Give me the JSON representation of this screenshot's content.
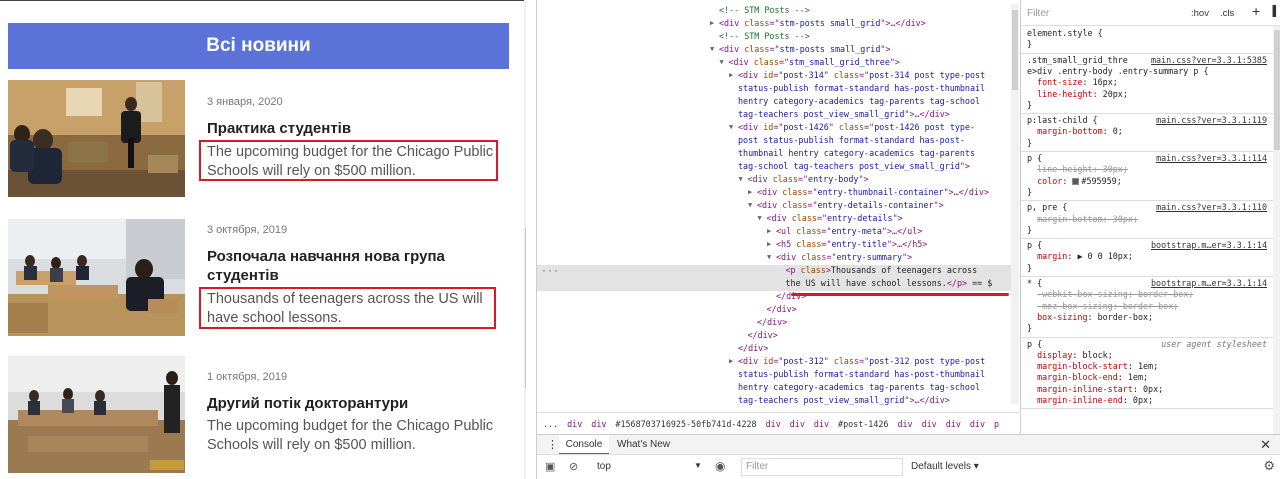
{
  "site": {
    "banner_title": "Всі новини",
    "posts": [
      {
        "date": "3 января, 2020",
        "title": "Практика студентів",
        "summary": "The upcoming budget for the Chicago Public Schools will rely on $500 million."
      },
      {
        "date": "3 октября, 2019",
        "title": "Розпочала навчання нова група студентів",
        "summary": "Thousands of teenagers across the US will have school lessons."
      },
      {
        "date": "1 октября, 2019",
        "title": "Другий потік докторантури",
        "summary": "The upcoming budget for the Chicago Public Schools will rely on $500 million."
      }
    ]
  },
  "devtools": {
    "elements": {
      "lines": [
        {
          "indent": 0,
          "tri": "",
          "html": "<span class='cmt'>&lt;!-- STM Posts --&gt;</span>"
        },
        {
          "indent": 0,
          "tri": "▶",
          "html": "<span class='tag'>&lt;div</span> <span class='attr'>class</span>=\"<span class='val'>stm-posts small_grid</span>\"<span class='tag'>&gt;</span>…<span class='tag'>&lt;/div&gt;</span>"
        },
        {
          "indent": 0,
          "tri": "",
          "html": "<span class='cmt'>&lt;!-- STM Posts --&gt;</span>"
        },
        {
          "indent": 0,
          "tri": "▼",
          "html": "<span class='tag'>&lt;div</span> <span class='attr'>class</span>=\"<span class='val'>stm-posts small_grid</span>\"<span class='tag'>&gt;</span>"
        },
        {
          "indent": 1,
          "tri": "▼",
          "html": "<span class='tag'>&lt;div</span> <span class='attr'>class</span>=\"<span class='val'>stm_small_grid_three</span>\"<span class='tag'>&gt;</span>"
        },
        {
          "indent": 2,
          "tri": "▶",
          "html": "<span class='tag'>&lt;div</span> <span class='attr'>id</span>=\"<span class='val'>post-314</span>\" <span class='attr'>class</span>=\"<span class='val'>post-314 post type-post</span>"
        },
        {
          "indent": 2,
          "tri": "",
          "html": "<span class='val'>status-publish format-standard has-post-thumbnail</span>"
        },
        {
          "indent": 2,
          "tri": "",
          "html": "<span class='val'>hentry category-academics tag-parents tag-school</span>"
        },
        {
          "indent": 2,
          "tri": "",
          "html": "<span class='val'>tag-teachers post_view_small_grid</span>\"<span class='tag'>&gt;</span>…<span class='tag'>&lt;/div&gt;</span>"
        },
        {
          "indent": 2,
          "tri": "▼",
          "html": "<span class='tag'>&lt;div</span> <span class='attr'>id</span>=\"<span class='val'>post-1426</span>\" <span class='attr'>class</span>=\"<span class='val'>post-1426 post type-</span>"
        },
        {
          "indent": 2,
          "tri": "",
          "html": "<span class='val'>post status-publish format-standard has-post-</span>"
        },
        {
          "indent": 2,
          "tri": "",
          "html": "<span class='val'>thumbnail hentry category-academics tag-parents</span>"
        },
        {
          "indent": 2,
          "tri": "",
          "html": "<span class='val'>tag-school tag-teachers post_view_small_grid</span>\"<span class='tag'>&gt;</span>"
        },
        {
          "indent": 3,
          "tri": "▼",
          "html": "<span class='tag'>&lt;div</span> <span class='attr'>class</span>=\"<span class='val'>entry-body</span>\"<span class='tag'>&gt;</span>"
        },
        {
          "indent": 4,
          "tri": "▶",
          "html": "<span class='tag'>&lt;div</span> <span class='attr'>class</span>=\"<span class='val'>entry-thumbnail-container</span>\"<span class='tag'>&gt;</span>…<span class='tag'>&lt;/div&gt;</span>"
        },
        {
          "indent": 4,
          "tri": "▼",
          "html": "<span class='tag'>&lt;div</span> <span class='attr'>class</span>=\"<span class='val'>entry-details-container</span>\"<span class='tag'>&gt;</span>"
        },
        {
          "indent": 5,
          "tri": "▼",
          "html": "<span class='tag'>&lt;div</span> <span class='attr'>class</span>=\"<span class='val'>entry-details</span>\"<span class='tag'>&gt;</span>"
        },
        {
          "indent": 6,
          "tri": "▶",
          "html": "<span class='tag'>&lt;ul</span> <span class='attr'>class</span>=\"<span class='val'>entry-meta</span>\"<span class='tag'>&gt;</span>…<span class='tag'>&lt;/ul&gt;</span>"
        },
        {
          "indent": 6,
          "tri": "▶",
          "html": "<span class='tag'>&lt;h5</span> <span class='attr'>class</span>=\"<span class='val'>entry-title</span>\"<span class='tag'>&gt;</span>…<span class='tag'>&lt;/h5&gt;</span>"
        },
        {
          "indent": 6,
          "tri": "▼",
          "html": "<span class='tag'>&lt;div</span> <span class='attr'>class</span>=\"<span class='val'>entry-summary</span>\"<span class='tag'>&gt;</span>"
        },
        {
          "indent": 7,
          "tri": "",
          "html": "<span class='tag'>&lt;p</span> <span class='attr'>class</span><span class='tag'>&gt;</span><span class='txt'>Thousands of teenagers across</span>"
        },
        {
          "indent": 7,
          "tri": "",
          "html": "<span class='txt'>the US will have school lessons.</span><span class='tag'>&lt;/p&gt;</span> <span class='txt'>== $</span>"
        },
        {
          "indent": 6,
          "tri": "",
          "html": "<span class='tag'>&lt;/div&gt;</span>"
        },
        {
          "indent": 5,
          "tri": "",
          "html": "<span class='tag'>&lt;/div&gt;</span>"
        },
        {
          "indent": 4,
          "tri": "",
          "html": "<span class='tag'>&lt;/div&gt;</span>"
        },
        {
          "indent": 3,
          "tri": "",
          "html": "<span class='tag'>&lt;/div&gt;</span>"
        },
        {
          "indent": 2,
          "tri": "",
          "html": "<span class='tag'>&lt;/div&gt;</span>"
        },
        {
          "indent": 2,
          "tri": "▶",
          "html": "<span class='tag'>&lt;div</span> <span class='attr'>id</span>=\"<span class='val'>post-312</span>\" <span class='attr'>class</span>=\"<span class='val'>post-312 post type-post</span>"
        },
        {
          "indent": 2,
          "tri": "",
          "html": "<span class='val'>status-publish format-standard has-post-thumbnail</span>"
        },
        {
          "indent": 2,
          "tri": "",
          "html": "<span class='val'>hentry category-academics tag-parents tag-school</span>"
        },
        {
          "indent": 2,
          "tri": "",
          "html": "<span class='val'>tag-teachers post_view_small_grid</span>\"<span class='tag'>&gt;</span>…<span class='tag'>&lt;/div&gt;</span>"
        }
      ],
      "selected_dots": "···"
    },
    "breadcrumb": [
      "...",
      "div",
      "div",
      "#1568703716925-50fb741d-4228",
      "div",
      "div",
      "div",
      "#post-1426",
      "div",
      "div",
      "div",
      "div",
      "p"
    ],
    "styles": {
      "filter_placeholder": "Filter",
      "hov": ":hov",
      "cls": ".cls",
      "plus": "+",
      "rules": [
        {
          "lines": [
            "<span class='pval'>element.style {</span>",
            "<span class='pval'>}</span>"
          ],
          "src": ""
        },
        {
          "lines": [
            "<span class='pval'>.stm_small_grid_thre</span>",
            "<span class='pval'>e&gt;div .entry-body .entry-summary p {</span>",
            "  <span class='pname'>font-size</span>: <span class='pval'>16px;</span>",
            "  <span class='pname'>line-height</span>: <span class='pval'>20px;</span>",
            "<span class='pval'>}</span>"
          ],
          "src": "main.css?ver=3.3.1:5385"
        },
        {
          "lines": [
            "<span class='pval'>p:last-child {</span>",
            "  <span class='pname'>margin-bottom</span>: <span class='pval'>0;</span>",
            "<span class='pval'>}</span>"
          ],
          "src": "main.css?ver=3.3.1:119"
        },
        {
          "lines": [
            "<span class='pval'>p {</span>",
            "  <span class='strike'><span class='pname'>line-height</span>: 30px;</span>",
            "  <span class='pname'>color</span>: <span class='swatch'></span><span class='pval'>#595959;</span>",
            "<span class='pval'>}</span>"
          ],
          "src": "main.css?ver=3.3.1:114"
        },
        {
          "lines": [
            "<span class='pval'>p, pre {</span>",
            "  <span class='strike'><span class='pname'>margin-bottom</span>: 30px;</span>",
            "<span class='pval'>}</span>"
          ],
          "src": "main.css?ver=3.3.1:110"
        },
        {
          "lines": [
            "<span class='pval'>p {</span>",
            "  <span class='pname'>margin</span>: <span class='pval'>▶ 0 0 10px;</span>",
            "<span class='pval'>}</span>"
          ],
          "src": "bootstrap.m…er=3.3.1:14"
        },
        {
          "lines": [
            "<span class='pval'>* {</span>",
            "  <span class='strike'><span class='pname'>-webkit-box-sizing</span>: border-box;</span>",
            "  <span class='strike'><span class='pname'>-moz-box-sizing</span>: border-box;</span>",
            "  <span class='pname'>box-sizing</span>: <span class='pval'>border-box;</span>",
            "<span class='pval'>}</span>"
          ],
          "src": "bootstrap.m…er=3.3.1:14"
        },
        {
          "lines": [
            "<span class='pval'>p {</span>",
            "  <span class='pname'>display</span>: <span class='pval'>block;</span>",
            "  <span class='pname'>margin-block-start</span>: <span class='pval'>1em;</span>",
            "  <span class='pname'>margin-block-end</span>: <span class='pval'>1em;</span>",
            "  <span class='pname'>margin-inline-start</span>: <span class='pval'>0px;</span>",
            "  <span class='pname'>margin-inline-end</span>: <span class='pval'>0px;</span>"
          ],
          "src": "user agent stylesheet"
        }
      ]
    },
    "drawer": {
      "tab_console": "Console",
      "tab_whatsnew": "What's New",
      "context": "top",
      "filter_placeholder": "Filter",
      "levels": "Default levels ▾"
    }
  }
}
